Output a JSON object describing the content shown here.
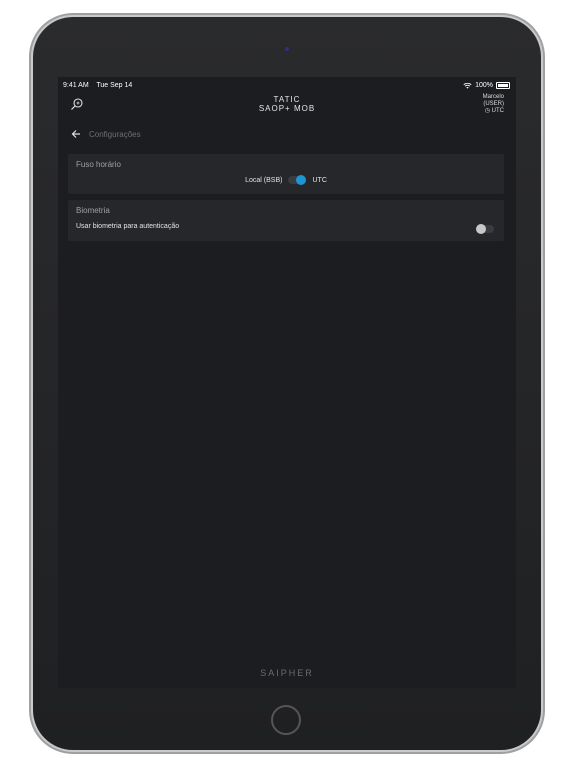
{
  "status_bar": {
    "time": "9:41 AM",
    "date": "Tue Sep 14",
    "battery": "100%"
  },
  "header": {
    "title_line1": "TATIC",
    "title_line2": "SAOP+ MOB",
    "user_name": "Marcelo",
    "user_role": "(USER)",
    "timezone": "UTC",
    "icon": "plane-search-icon"
  },
  "nav": {
    "title": "Configurações"
  },
  "timezone_card": {
    "title": "Fuso horário",
    "local_label": "Local (BSB)",
    "utc_label": "UTC",
    "selected": "UTC"
  },
  "biometrics_card": {
    "title": "Biometria",
    "label": "Usar biometria para autenticação",
    "enabled": false
  },
  "footer": {
    "brand": "SAIPHER"
  },
  "colors": {
    "accent": "#1e95d4",
    "background": "#1c1d21",
    "card": "#26272b"
  }
}
